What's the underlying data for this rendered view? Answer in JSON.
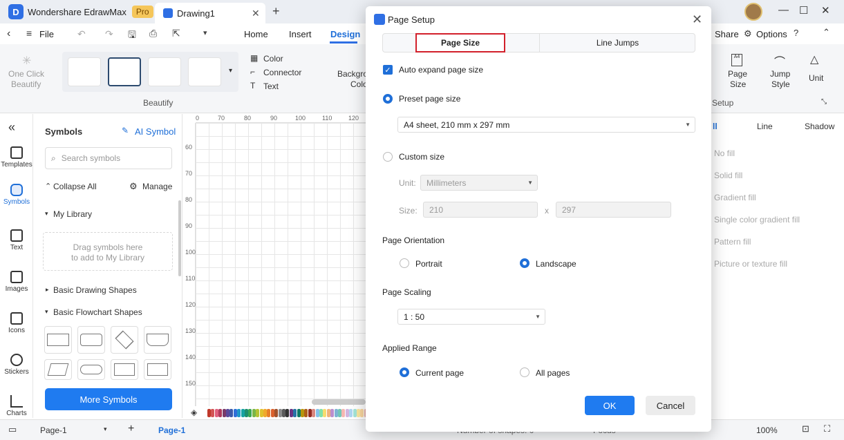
{
  "titlebar": {
    "app_name": "Wondershare EdrawMax",
    "pro_badge": "Pro",
    "doc_tab": "Drawing1",
    "close_tab": "✕",
    "new_tab": "+",
    "minimize": "—",
    "maximize": "☐",
    "close_window": "✕"
  },
  "menubar": {
    "file": "File",
    "tabs": [
      "Home",
      "Insert",
      "Design"
    ],
    "share": "Share",
    "options": "Options"
  },
  "ribbon": {
    "one_click": "One Click",
    "beautify_small": "Beautify",
    "beautify_group": "Beautify",
    "color": "Color",
    "connector": "Connector",
    "text": "Text",
    "background_partial": "Backgro",
    "background_partial2": "Colo",
    "page_size": "Page Size",
    "page_size_l1": "Page",
    "page_size_l2": "Size",
    "jump_style_l1": "Jump",
    "jump_style_l2": "Style",
    "unit": "Unit",
    "setup_group": "Setup"
  },
  "rail": {
    "items": [
      "Templates",
      "Symbols",
      "Text",
      "Images",
      "Icons",
      "Stickers",
      "Charts"
    ]
  },
  "symbols": {
    "title": "Symbols",
    "ai_symbol": "AI Symbol",
    "search_placeholder": "Search symbols",
    "collapse_all": "Collapse All",
    "manage": "Manage",
    "my_library": "My Library",
    "drag_hint_1": "Drag symbols here",
    "drag_hint_2": "to add to My Library",
    "basic_drawing": "Basic Drawing Shapes",
    "basic_flowchart": "Basic Flowchart Shapes",
    "more_symbols": "More Symbols"
  },
  "ruler": {
    "top": [
      "0",
      "70",
      "80",
      "90",
      "100",
      "110",
      "120"
    ],
    "left": [
      "60",
      "70",
      "80",
      "90",
      "100",
      "110",
      "120",
      "130",
      "140",
      "150"
    ]
  },
  "right_panel": {
    "tabs": [
      "ll",
      "Line",
      "Shadow"
    ],
    "fill_options": [
      "No fill",
      "Solid fill",
      "Gradient fill",
      "Single color gradient fill",
      "Pattern fill",
      "Picture or texture fill"
    ]
  },
  "statusbar": {
    "page_select": "Page-1",
    "page_tab": "Page-1",
    "shapes_partial": "Number of shapes: 0",
    "focus_partial": "Focus",
    "zoom": "100%"
  },
  "dialog": {
    "title": "Page Setup",
    "tab_page_size": "Page Size",
    "tab_line_jumps": "Line Jumps",
    "auto_expand": "Auto expand page size",
    "auto_expand_checked": true,
    "preset": "Preset page size",
    "preset_value": "A4 sheet, 210 mm x 297 mm",
    "custom": "Custom size",
    "unit_label": "Unit:",
    "unit_value": "Millimeters",
    "size_label": "Size:",
    "size_w": "210",
    "size_x": "x",
    "size_h": "297",
    "orientation_label": "Page Orientation",
    "portrait": "Portrait",
    "landscape": "Landscape",
    "scaling_label": "Page Scaling",
    "scaling_value": "1 : 50",
    "range_label": "Applied Range",
    "current_page": "Current page",
    "all_pages": "All pages",
    "ok": "OK",
    "cancel": "Cancel"
  },
  "colors": {
    "accent": "#1f7bf0",
    "highlight_box": "#d21f2a"
  }
}
